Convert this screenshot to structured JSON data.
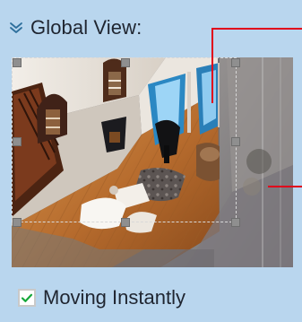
{
  "global_view": {
    "title": "Global View:",
    "collapse_icon": "double-chevron-down-icon"
  },
  "options": {
    "moving_instantly_label": "Moving Instantly",
    "moving_instantly_checked": true
  },
  "colors": {
    "background": "#b9d6ee",
    "handle": "#8f8f8f",
    "marker_line": "#e0001b"
  }
}
